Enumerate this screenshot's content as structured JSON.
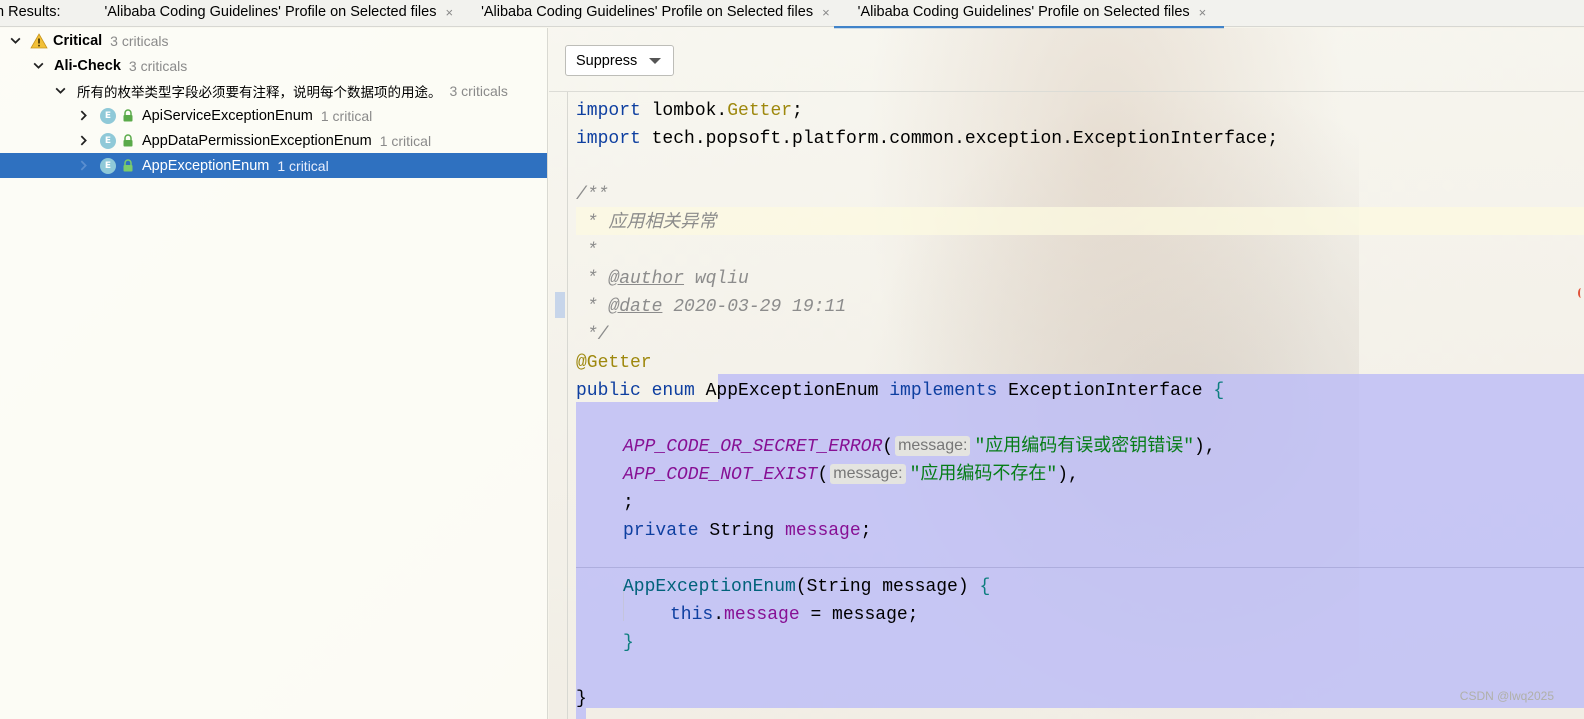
{
  "tabs": {
    "prefix": "n Results:",
    "items": [
      {
        "label": "'Alibaba Coding Guidelines' Profile on Selected files"
      },
      {
        "label": "'Alibaba Coding Guidelines' Profile on Selected files"
      },
      {
        "label": "'Alibaba Coding Guidelines' Profile on Selected files"
      }
    ],
    "close_glyph": "×"
  },
  "tree": {
    "critical": {
      "label": "Critical",
      "count": "3 criticals"
    },
    "alicheck": {
      "label": "Ali-Check",
      "count": "3 criticals"
    },
    "rule": {
      "label": "所有的枚举类型字段必须要有注释，说明每个数据项的用途。",
      "count": "3 criticals"
    },
    "files": [
      {
        "badge": "E",
        "name": "ApiServiceExceptionEnum",
        "count": "1 critical"
      },
      {
        "badge": "E",
        "name": "AppDataPermissionExceptionEnum",
        "count": "1 critical"
      },
      {
        "badge": "E",
        "name": "AppExceptionEnum",
        "count": "1 critical"
      }
    ]
  },
  "toolbar": {
    "suppress_label": "Suppress"
  },
  "code": {
    "l1": {
      "kw": "import",
      "pkg": " lombok.",
      "cls": "Getter",
      "end": ";"
    },
    "l2": {
      "kw": "import",
      "rest": " tech.popsoft.platform.common.exception.ExceptionInterface;"
    },
    "l4": "/**",
    "l5": " * 应用相关异常",
    "l6": " *",
    "l7": {
      "pre": " * ",
      "tag": "@author",
      "val": " wqliu"
    },
    "l8": {
      "pre": " * ",
      "tag": "@date",
      "val": " 2020-03-29 19:11"
    },
    "l9": " */",
    "l10": "@Getter",
    "l11": {
      "kw1": "public",
      "kw2": " enum ",
      "name": "AppExceptionEnum",
      "kw3": " implements ",
      "iface": "ExceptionInterface",
      "brace": " {"
    },
    "l13": {
      "name": "APP_CODE_OR_SECRET_ERROR",
      "open": "(",
      "hint": "message:",
      "str": "\"应用编码有误或密钥错误\"",
      "close": "),"
    },
    "l14": {
      "name": "APP_CODE_NOT_EXIST",
      "open": "(",
      "hint": "message:",
      "str": "\"应用编码不存在\"",
      "close": "),"
    },
    "l15": ";",
    "l16": {
      "kw": "private",
      "type": " String ",
      "field": "message",
      "end": ";"
    },
    "l18": {
      "ctor": "AppExceptionEnum",
      "params": "(String message) ",
      "brace": "{"
    },
    "l19": {
      "kw": "this",
      "dot": ".",
      "field": "message",
      "rest": " = message;"
    },
    "l20": "}",
    "l22": "}"
  },
  "watermark": "CSDN @lwq2025"
}
